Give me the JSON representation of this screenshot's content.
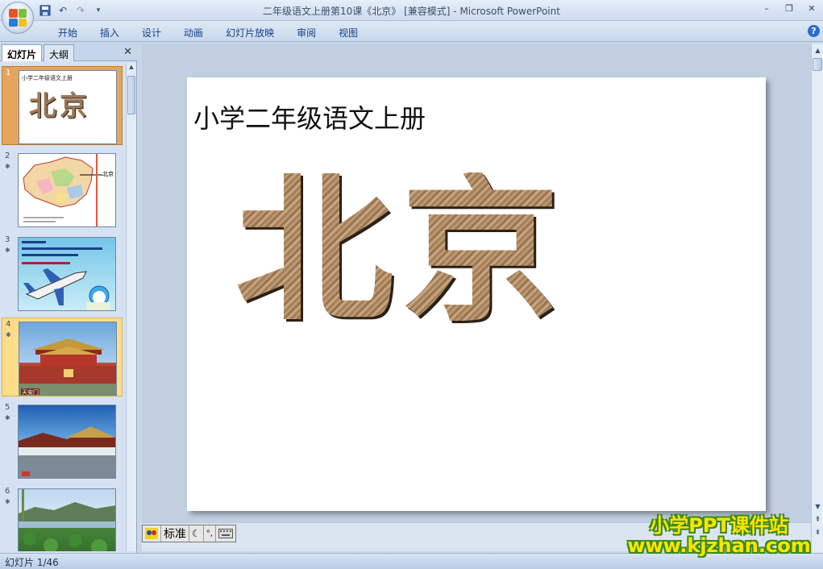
{
  "window": {
    "title": "二年级语文上册第10课《北京》 [兼容模式] - Microsoft PowerPoint",
    "controls": [
      "minimize-icon",
      "restore-icon",
      "close-icon"
    ]
  },
  "quick_access": {
    "icons": [
      "save-icon",
      "undo-icon",
      "redo-icon",
      "customize-icon"
    ]
  },
  "ribbon": {
    "tabs": [
      "开始",
      "插入",
      "设计",
      "动画",
      "幻灯片放映",
      "审阅",
      "视图"
    ],
    "help_glyph": "?"
  },
  "left_pane": {
    "tabs": {
      "slides": "幻灯片",
      "outline": "大纲"
    },
    "close_glyph": "✕",
    "thumbnails": [
      {
        "number": "1",
        "state": "selected",
        "caption": "小学二年级语文上册",
        "title": "北京"
      },
      {
        "number": "2",
        "state": "normal",
        "label": "北京"
      },
      {
        "number": "3",
        "state": "normal"
      },
      {
        "number": "4",
        "state": "hover",
        "label": "天安门"
      },
      {
        "number": "5",
        "state": "normal"
      },
      {
        "number": "6",
        "state": "normal"
      }
    ]
  },
  "slide": {
    "subtitle": "小学二年级语文上册",
    "title": "北京"
  },
  "ime_bar": {
    "mode_label": "标准",
    "icons": [
      "ime-logo-icon",
      "moon-icon",
      "punctuation-icon",
      "keyboard-icon"
    ]
  },
  "status_bar": {
    "slide_counter": "幻灯片 1/46"
  },
  "watermark": {
    "line1": "小学PPT课件站",
    "line2": "www.kjzhan.com"
  },
  "colors": {
    "ribbon_text": "#15428b",
    "selected_thumb": "#e6a55b",
    "hover_thumb": "#fddc8a",
    "watermark_fill": "#ffe400",
    "watermark_outline": "#3a8a1a"
  }
}
